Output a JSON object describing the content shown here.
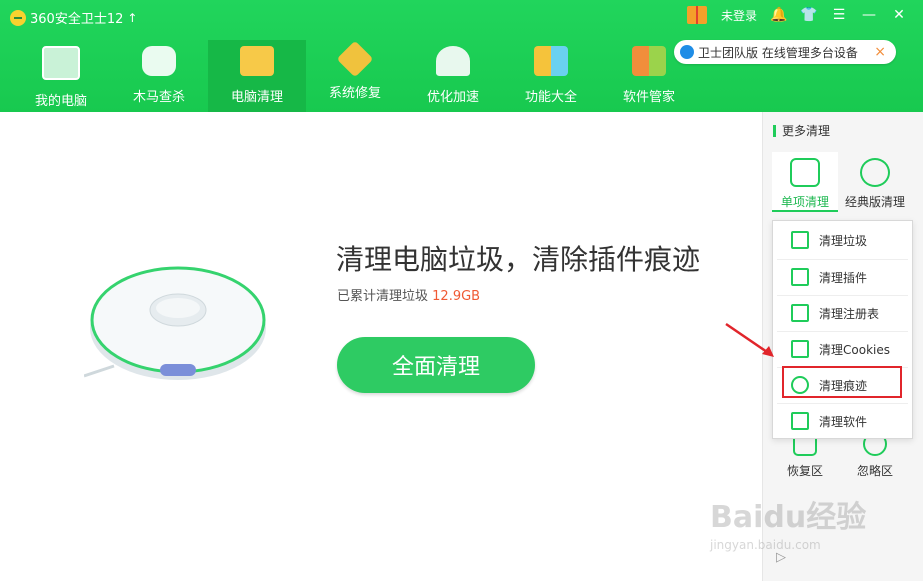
{
  "window": {
    "title": "360安全卫士12",
    "login": "未登录"
  },
  "nav": {
    "items": [
      {
        "label": "我的电脑"
      },
      {
        "label": "木马查杀"
      },
      {
        "label": "电脑清理"
      },
      {
        "label": "系统修复"
      },
      {
        "label": "优化加速"
      },
      {
        "label": "功能大全"
      },
      {
        "label": "软件管家"
      }
    ],
    "active_index": 2
  },
  "banner": {
    "text": "卫士团队版 在线管理多台设备",
    "close": "×"
  },
  "main": {
    "headline": "清理电脑垃圾，清除插件痕迹",
    "cumulative_label": "已累计清理垃圾",
    "cumulative_value": "12.9GB",
    "clean_button": "全面清理"
  },
  "sidebar": {
    "section_title": "更多清理",
    "tabs": [
      {
        "label": "单项清理"
      },
      {
        "label": "经典版清理"
      }
    ],
    "menu": [
      {
        "label": "清理垃圾"
      },
      {
        "label": "清理插件"
      },
      {
        "label": "清理注册表"
      },
      {
        "label": "清理Cookies"
      },
      {
        "label": "清理痕迹"
      },
      {
        "label": "清理软件"
      }
    ],
    "restore_label": "恢复区",
    "ignore_label": "忽略区"
  },
  "watermark": {
    "text": "Baidu经验",
    "sub": "jingyan.baidu.com"
  },
  "colors": {
    "brand": "#1fd35a",
    "accent_red": "#e1252b",
    "value_orange": "#f05a34"
  }
}
